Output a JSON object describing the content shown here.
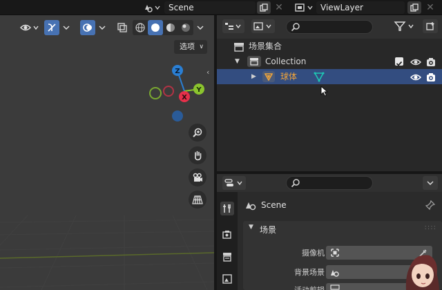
{
  "topbar": {
    "scene_name": "Scene",
    "view_layer_name": "ViewLayer"
  },
  "viewport": {
    "options_label": "选项",
    "gizmo": {
      "z_label": "Z",
      "x_label": "X",
      "y_label": "Y"
    },
    "colors": {
      "x_axis": "#e5304a",
      "y_axis": "#8bc42e",
      "z_axis": "#2a7fd4"
    }
  },
  "outliner": {
    "search_placeholder": "",
    "rows": [
      {
        "label": "场景集合"
      },
      {
        "label": "Collection"
      },
      {
        "label": "球体"
      }
    ],
    "colors": {
      "selection": "#334d80",
      "object_label": "#f0a43a",
      "mesh_data": "#1ec7b4"
    }
  },
  "properties": {
    "search_placeholder": "",
    "scene_title": "Scene",
    "panel_title": "场景",
    "fields": [
      {
        "label": "摄像机"
      },
      {
        "label": "背景场景"
      },
      {
        "label": "活动剪辑"
      }
    ]
  }
}
